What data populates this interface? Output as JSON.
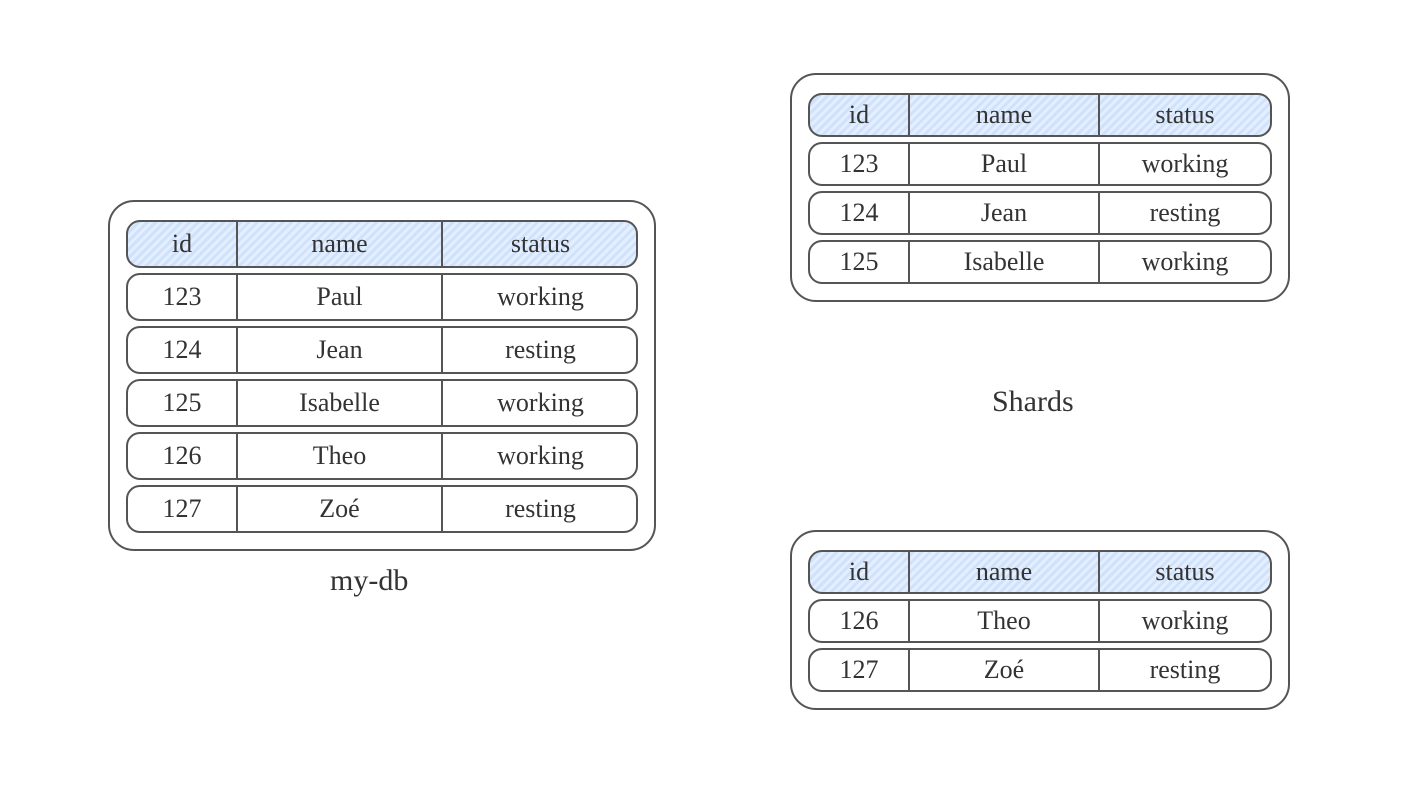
{
  "labels": {
    "main_caption": "my-db",
    "shards_caption": "Shards"
  },
  "columns": {
    "id": "id",
    "name": "name",
    "status": "status"
  },
  "main_table": {
    "rows": [
      {
        "id": "123",
        "name": "Paul",
        "status": "working"
      },
      {
        "id": "124",
        "name": "Jean",
        "status": "resting"
      },
      {
        "id": "125",
        "name": "Isabelle",
        "status": "working"
      },
      {
        "id": "126",
        "name": "Theo",
        "status": "working"
      },
      {
        "id": "127",
        "name": "Zoé",
        "status": "resting"
      }
    ]
  },
  "shard1": {
    "rows": [
      {
        "id": "123",
        "name": "Paul",
        "status": "working"
      },
      {
        "id": "124",
        "name": "Jean",
        "status": "resting"
      },
      {
        "id": "125",
        "name": "Isabelle",
        "status": "working"
      }
    ]
  },
  "shard2": {
    "rows": [
      {
        "id": "126",
        "name": "Theo",
        "status": "working"
      },
      {
        "id": "127",
        "name": "Zoé",
        "status": "resting"
      }
    ]
  }
}
